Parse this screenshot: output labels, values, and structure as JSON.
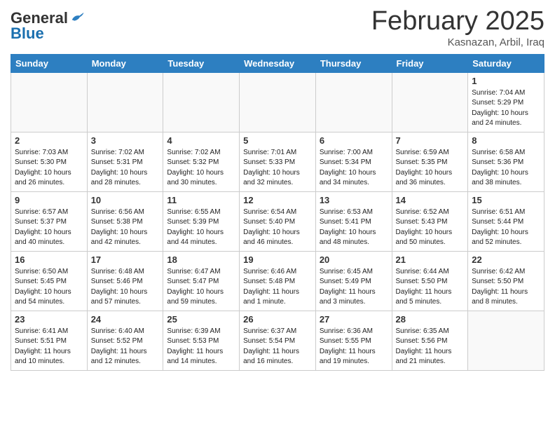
{
  "logo": {
    "general": "General",
    "blue": "Blue"
  },
  "header": {
    "month": "February 2025",
    "location": "Kasnazan, Arbil, Iraq"
  },
  "weekdays": [
    "Sunday",
    "Monday",
    "Tuesday",
    "Wednesday",
    "Thursday",
    "Friday",
    "Saturday"
  ],
  "weeks": [
    [
      {
        "day": "",
        "info": ""
      },
      {
        "day": "",
        "info": ""
      },
      {
        "day": "",
        "info": ""
      },
      {
        "day": "",
        "info": ""
      },
      {
        "day": "",
        "info": ""
      },
      {
        "day": "",
        "info": ""
      },
      {
        "day": "1",
        "info": "Sunrise: 7:04 AM\nSunset: 5:29 PM\nDaylight: 10 hours and 24 minutes."
      }
    ],
    [
      {
        "day": "2",
        "info": "Sunrise: 7:03 AM\nSunset: 5:30 PM\nDaylight: 10 hours and 26 minutes."
      },
      {
        "day": "3",
        "info": "Sunrise: 7:02 AM\nSunset: 5:31 PM\nDaylight: 10 hours and 28 minutes."
      },
      {
        "day": "4",
        "info": "Sunrise: 7:02 AM\nSunset: 5:32 PM\nDaylight: 10 hours and 30 minutes."
      },
      {
        "day": "5",
        "info": "Sunrise: 7:01 AM\nSunset: 5:33 PM\nDaylight: 10 hours and 32 minutes."
      },
      {
        "day": "6",
        "info": "Sunrise: 7:00 AM\nSunset: 5:34 PM\nDaylight: 10 hours and 34 minutes."
      },
      {
        "day": "7",
        "info": "Sunrise: 6:59 AM\nSunset: 5:35 PM\nDaylight: 10 hours and 36 minutes."
      },
      {
        "day": "8",
        "info": "Sunrise: 6:58 AM\nSunset: 5:36 PM\nDaylight: 10 hours and 38 minutes."
      }
    ],
    [
      {
        "day": "9",
        "info": "Sunrise: 6:57 AM\nSunset: 5:37 PM\nDaylight: 10 hours and 40 minutes."
      },
      {
        "day": "10",
        "info": "Sunrise: 6:56 AM\nSunset: 5:38 PM\nDaylight: 10 hours and 42 minutes."
      },
      {
        "day": "11",
        "info": "Sunrise: 6:55 AM\nSunset: 5:39 PM\nDaylight: 10 hours and 44 minutes."
      },
      {
        "day": "12",
        "info": "Sunrise: 6:54 AM\nSunset: 5:40 PM\nDaylight: 10 hours and 46 minutes."
      },
      {
        "day": "13",
        "info": "Sunrise: 6:53 AM\nSunset: 5:41 PM\nDaylight: 10 hours and 48 minutes."
      },
      {
        "day": "14",
        "info": "Sunrise: 6:52 AM\nSunset: 5:43 PM\nDaylight: 10 hours and 50 minutes."
      },
      {
        "day": "15",
        "info": "Sunrise: 6:51 AM\nSunset: 5:44 PM\nDaylight: 10 hours and 52 minutes."
      }
    ],
    [
      {
        "day": "16",
        "info": "Sunrise: 6:50 AM\nSunset: 5:45 PM\nDaylight: 10 hours and 54 minutes."
      },
      {
        "day": "17",
        "info": "Sunrise: 6:48 AM\nSunset: 5:46 PM\nDaylight: 10 hours and 57 minutes."
      },
      {
        "day": "18",
        "info": "Sunrise: 6:47 AM\nSunset: 5:47 PM\nDaylight: 10 hours and 59 minutes."
      },
      {
        "day": "19",
        "info": "Sunrise: 6:46 AM\nSunset: 5:48 PM\nDaylight: 11 hours and 1 minute."
      },
      {
        "day": "20",
        "info": "Sunrise: 6:45 AM\nSunset: 5:49 PM\nDaylight: 11 hours and 3 minutes."
      },
      {
        "day": "21",
        "info": "Sunrise: 6:44 AM\nSunset: 5:50 PM\nDaylight: 11 hours and 5 minutes."
      },
      {
        "day": "22",
        "info": "Sunrise: 6:42 AM\nSunset: 5:50 PM\nDaylight: 11 hours and 8 minutes."
      }
    ],
    [
      {
        "day": "23",
        "info": "Sunrise: 6:41 AM\nSunset: 5:51 PM\nDaylight: 11 hours and 10 minutes."
      },
      {
        "day": "24",
        "info": "Sunrise: 6:40 AM\nSunset: 5:52 PM\nDaylight: 11 hours and 12 minutes."
      },
      {
        "day": "25",
        "info": "Sunrise: 6:39 AM\nSunset: 5:53 PM\nDaylight: 11 hours and 14 minutes."
      },
      {
        "day": "26",
        "info": "Sunrise: 6:37 AM\nSunset: 5:54 PM\nDaylight: 11 hours and 16 minutes."
      },
      {
        "day": "27",
        "info": "Sunrise: 6:36 AM\nSunset: 5:55 PM\nDaylight: 11 hours and 19 minutes."
      },
      {
        "day": "28",
        "info": "Sunrise: 6:35 AM\nSunset: 5:56 PM\nDaylight: 11 hours and 21 minutes."
      },
      {
        "day": "",
        "info": ""
      }
    ]
  ]
}
